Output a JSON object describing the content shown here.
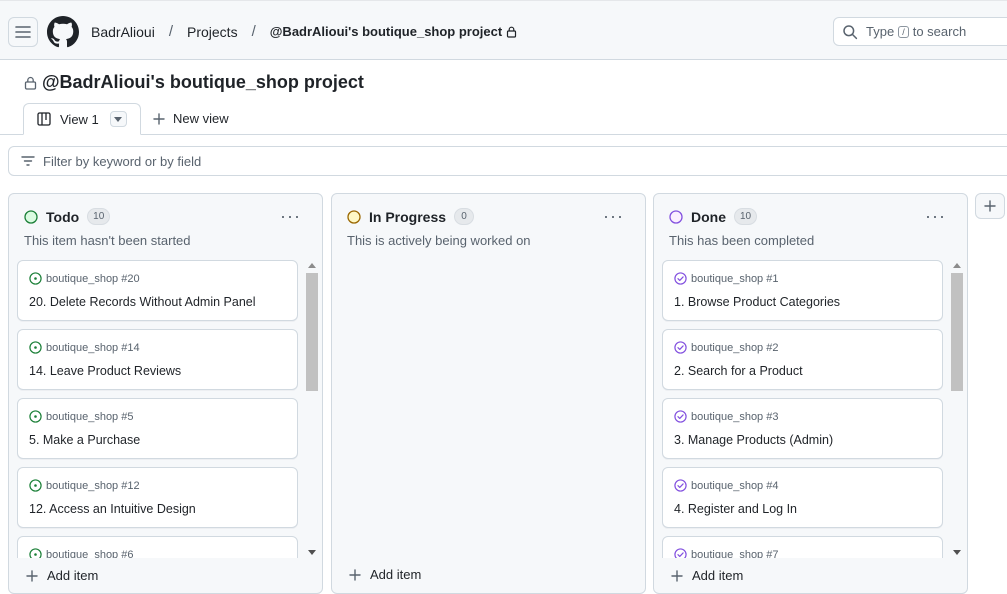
{
  "header": {
    "breadcrumbs": [
      "BadrAlioui",
      "Projects",
      "@BadrAlioui's boutique_shop project"
    ],
    "separator": "/",
    "search": {
      "text_before": "Type",
      "key": "/",
      "text_after": "to search"
    }
  },
  "project": {
    "title": "@BadrAlioui's boutique_shop project",
    "tabs": [
      {
        "label": "View 1"
      }
    ],
    "new_view_label": "New view",
    "filter_placeholder": "Filter by keyword or by field"
  },
  "columns": [
    {
      "name": "Todo",
      "count": "10",
      "description": "This item hasn't been started",
      "status_color": "#1a7f37",
      "add_label": "Add item",
      "cards": [
        {
          "ref": "boutique_shop #20",
          "title": "20. Delete Records Without Admin Panel"
        },
        {
          "ref": "boutique_shop #14",
          "title": "14. Leave Product Reviews"
        },
        {
          "ref": "boutique_shop #5",
          "title": "5. Make a Purchase"
        },
        {
          "ref": "boutique_shop #12",
          "title": "12. Access an Intuitive Design"
        },
        {
          "ref": "boutique_shop #6",
          "title": ""
        }
      ]
    },
    {
      "name": "In Progress",
      "count": "0",
      "description": "This is actively being worked on",
      "status_color": "#9a6700",
      "add_label": "Add item",
      "cards": []
    },
    {
      "name": "Done",
      "count": "10",
      "description": "This has been completed",
      "status_color": "#8250df",
      "add_label": "Add item",
      "cards": [
        {
          "ref": "boutique_shop #1",
          "title": "1. Browse Product Categories"
        },
        {
          "ref": "boutique_shop #2",
          "title": "2. Search for a Product"
        },
        {
          "ref": "boutique_shop #3",
          "title": "3. Manage Products (Admin)"
        },
        {
          "ref": "boutique_shop #4",
          "title": "4. Register and Log In"
        },
        {
          "ref": "boutique_shop #7",
          "title": ""
        }
      ]
    }
  ],
  "colors": {
    "todo": "#1a7f37",
    "in_progress": "#bf8700",
    "done": "#8250df",
    "border": "#d1d9e0"
  }
}
